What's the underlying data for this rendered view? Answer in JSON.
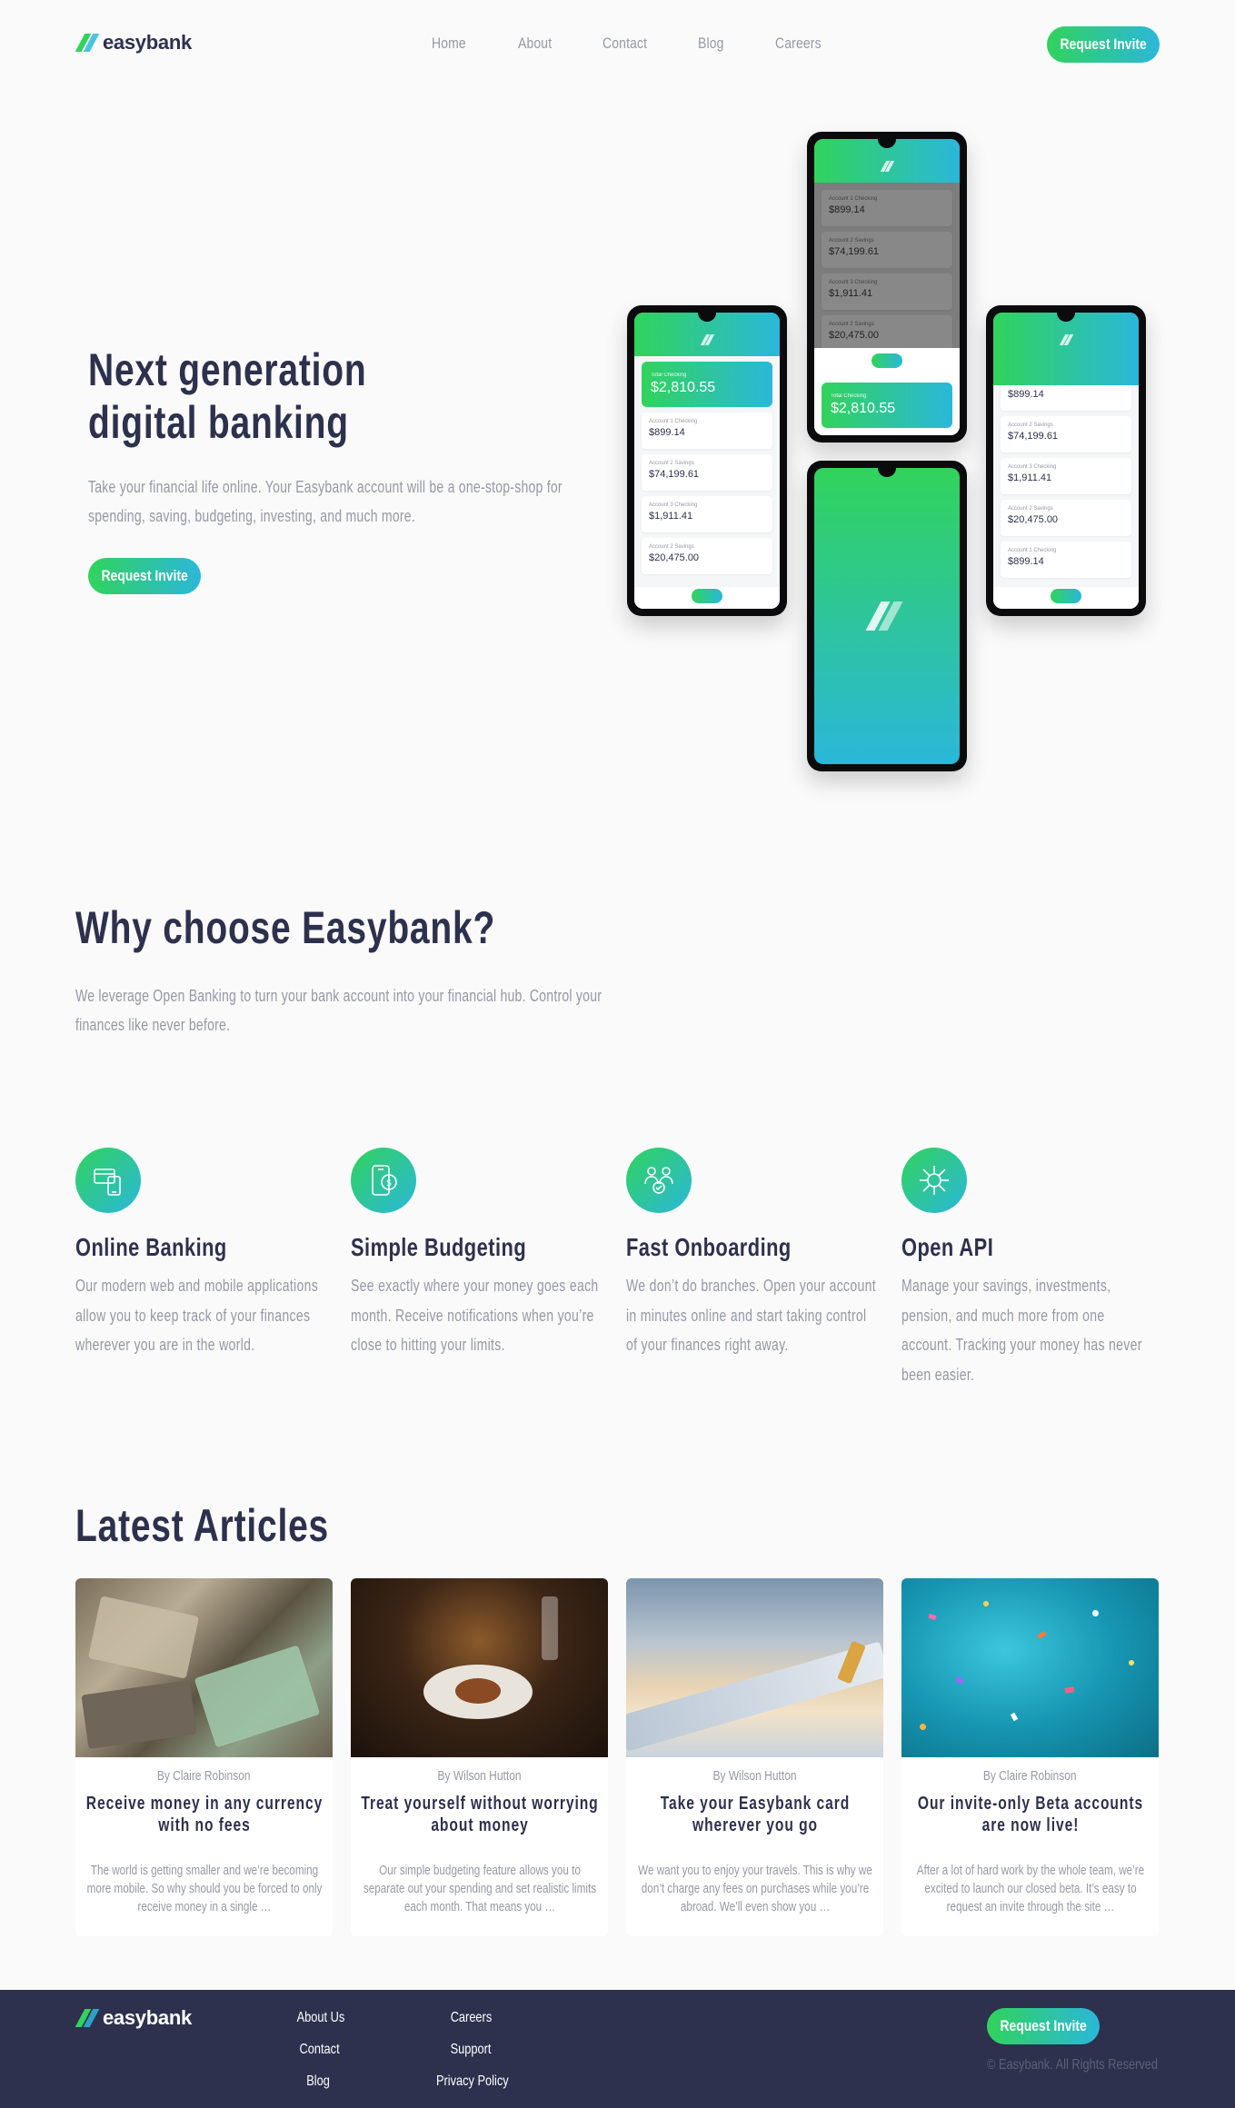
{
  "brand": {
    "name": "easybank",
    "accent_green": "#31d35c",
    "accent_blue": "#2bb7da",
    "dark": "#2d314d",
    "gray": "#9698a6"
  },
  "nav": {
    "items": [
      "Home",
      "About",
      "Contact",
      "Blog",
      "Careers"
    ]
  },
  "header": {
    "cta": "Request Invite"
  },
  "hero": {
    "title_line1": "Next generation",
    "title_line2": "digital banking",
    "text": "Take your financial life online. Your Easybank account will be a one-stop-shop for spending, saving, budgeting, investing, and much more.",
    "cta": "Request Invite"
  },
  "phones": {
    "total_label": "Total Checking",
    "total_amount": "$2,810.55",
    "accounts": [
      {
        "label": "Account 1 Checking",
        "amount": "$899.14"
      },
      {
        "label": "Account 2 Savings",
        "amount": "$74,199.61"
      },
      {
        "label": "Account 3 Checking",
        "amount": "$1,911.41"
      },
      {
        "label": "Account 2 Savings",
        "amount": "$20,475.00"
      },
      {
        "label": "Account 1 Checking",
        "amount": "$899.14"
      }
    ]
  },
  "why": {
    "title": "Why choose Easybank?",
    "text": "We leverage Open Banking to turn your bank account into your financial hub. Control your finances like never before."
  },
  "features": [
    {
      "icon": "online-banking-icon",
      "title": "Online Banking",
      "text": "Our modern web and mobile applications allow you to keep track of your finances wherever you are in the world."
    },
    {
      "icon": "budgeting-icon",
      "title": "Simple Budgeting",
      "text": "See exactly where your money goes each month. Receive notifications when you’re close to hitting your limits."
    },
    {
      "icon": "onboarding-icon",
      "title": "Fast Onboarding",
      "text": "We don’t do branches. Open your account in minutes online and start taking control of your finances right away."
    },
    {
      "icon": "api-icon",
      "title": "Open API",
      "text": "Manage your savings, investments, pension, and much more from one account. Tracking your money has never been easier."
    }
  ],
  "articles": {
    "title": "Latest Articles",
    "items": [
      {
        "author": "By Claire Robinson",
        "title": "Receive money in any currency with no fees",
        "excerpt": "The world is getting smaller and we’re becoming more mobile. So why should you be forced to only receive money in a single …"
      },
      {
        "author": "By Wilson Hutton",
        "title": "Treat yourself without worrying about money",
        "excerpt": "Our simple budgeting feature allows you to separate out your spending and set realistic limits each month. That means you …"
      },
      {
        "author": "By Wilson Hutton",
        "title": "Take your Easybank card wherever you go",
        "excerpt": "We want you to enjoy your travels. This is why we don’t charge any fees on purchases while you’re abroad. We’ll even show you …"
      },
      {
        "author": "By Claire Robinson",
        "title": "Our invite-only Beta accounts are now live!",
        "excerpt": "After a lot of hard work by the whole team, we’re excited to launch our closed beta. It’s easy to request an invite through the site …"
      }
    ]
  },
  "footer": {
    "links_col1": [
      "About Us",
      "Contact",
      "Blog"
    ],
    "links_col2": [
      "Careers",
      "Support",
      "Privacy Policy"
    ],
    "cta": "Request Invite",
    "copyright": "© Easybank. All Rights Reserved"
  }
}
